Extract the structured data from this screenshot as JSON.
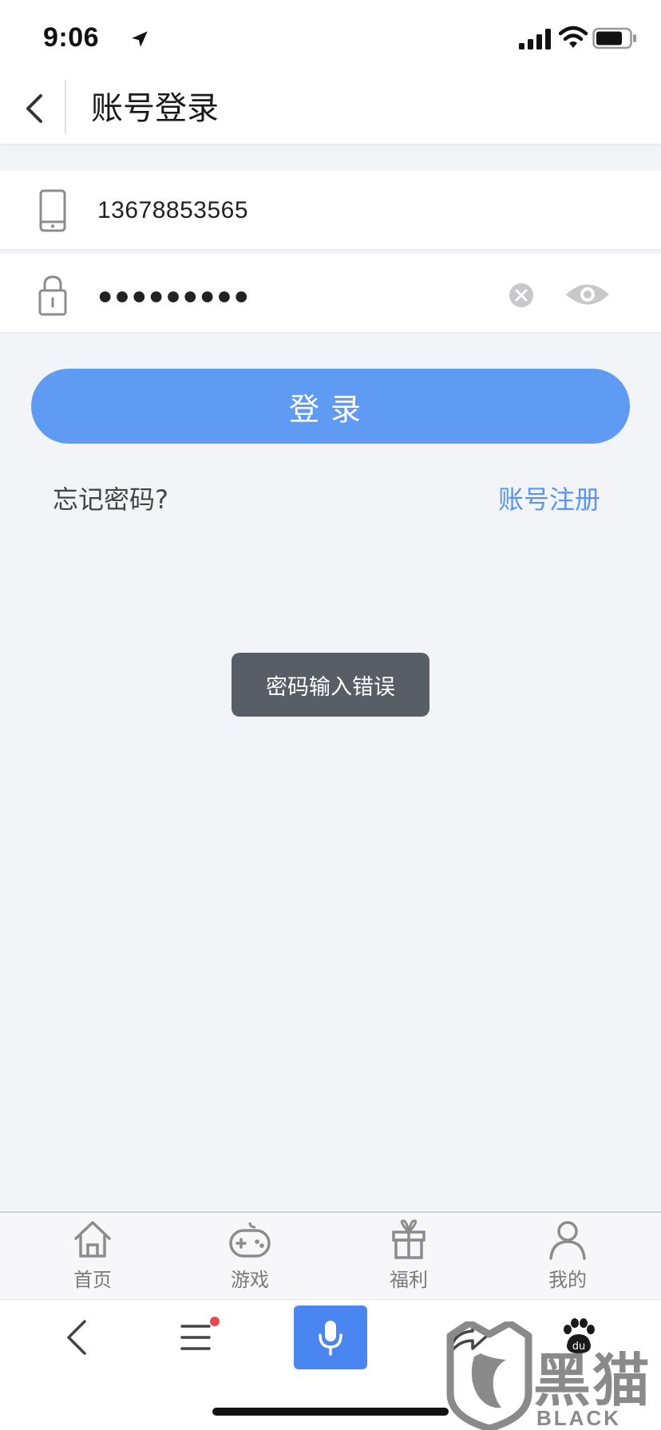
{
  "status_bar": {
    "time": "9:06",
    "icons": [
      "location-arrow-icon",
      "cellular-signal-icon",
      "wifi-icon",
      "battery-icon"
    ]
  },
  "header": {
    "back_icon": "chevron-left-icon",
    "title": "账号登录"
  },
  "login_form": {
    "phone": {
      "icon": "phone-icon",
      "value": "13678853565"
    },
    "password": {
      "icon": "lock-icon",
      "value": "●●●●●●●●●",
      "clear_icon": "clear-circle-icon",
      "toggle_icon": "eye-icon"
    },
    "submit_label": "登录",
    "forgot_label": "忘记密码?",
    "register_label": "账号注册"
  },
  "toast": {
    "message": "密码输入错误"
  },
  "tab_bar": {
    "items": [
      {
        "label": "首页",
        "icon": "home-icon"
      },
      {
        "label": "游戏",
        "icon": "gamepad-icon"
      },
      {
        "label": "福利",
        "icon": "gift-icon"
      },
      {
        "label": "我的",
        "icon": "user-icon"
      }
    ]
  },
  "browser_bar": {
    "icons": [
      "back-arrow-icon",
      "menu-icon",
      "microphone-icon",
      "share-icon"
    ],
    "has_notification_dot": true
  },
  "watermark": {
    "title": "黑猫",
    "subtitle": "BLACK CAT",
    "paw_label": "du"
  },
  "colors": {
    "accent": "#5f9bf3",
    "link": "#5a96f0",
    "toast_bg": "#595e66",
    "mic_button": "#4a86f2",
    "page_bg": "#f3f4f8",
    "notification_dot": "#e5484d"
  }
}
